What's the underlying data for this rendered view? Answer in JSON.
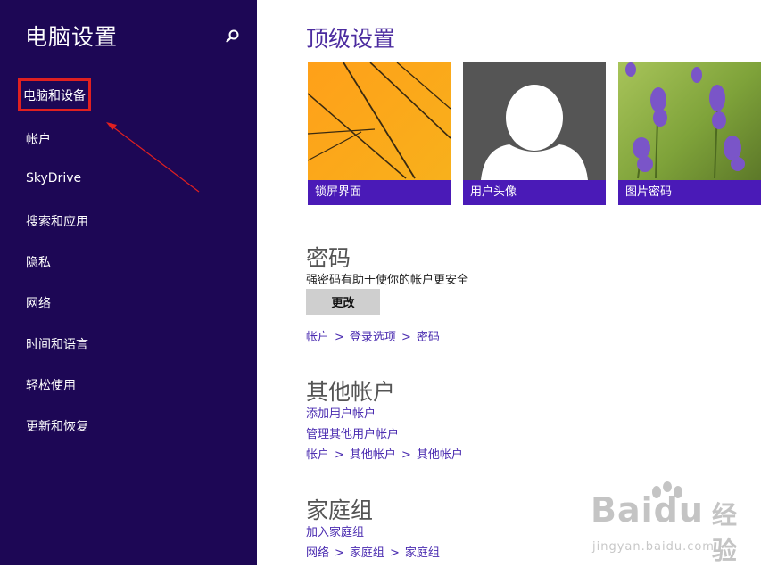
{
  "sidebar": {
    "title": "电脑设置",
    "items": [
      {
        "label": "电脑和设备"
      },
      {
        "label": "帐户"
      },
      {
        "label": "SkyDrive"
      },
      {
        "label": "搜索和应用"
      },
      {
        "label": "隐私"
      },
      {
        "label": "网络"
      },
      {
        "label": "时间和语言"
      },
      {
        "label": "轻松使用"
      },
      {
        "label": "更新和恢复"
      }
    ]
  },
  "main": {
    "title": "顶级设置",
    "tiles": [
      {
        "label": "锁屏界面"
      },
      {
        "label": "用户头像"
      },
      {
        "label": "图片密码"
      }
    ],
    "password": {
      "title": "密码",
      "description": "强密码有助于使你的帐户更安全",
      "button": "更改",
      "breadcrumb": [
        "帐户",
        "登录选项",
        "密码"
      ]
    },
    "other_accounts": {
      "title": "其他帐户",
      "links": [
        "添加用户帐户",
        "管理其他用户帐户"
      ],
      "breadcrumb": [
        "帐户",
        "其他帐户",
        "其他帐户"
      ]
    },
    "homegroup": {
      "title": "家庭组",
      "links": [
        "加入家庭组"
      ],
      "breadcrumb": [
        "网络",
        "家庭组",
        "家庭组"
      ]
    },
    "breadcrumb_separator": ">"
  },
  "watermark": {
    "brand": "Baidu",
    "jingyan": "经验",
    "url": "jingyan.baidu.com"
  },
  "colors": {
    "sidebar_bg": "#1d0755",
    "accent": "#4a1ab7",
    "highlight_box": "#e02020",
    "link": "#4a2bb0"
  }
}
